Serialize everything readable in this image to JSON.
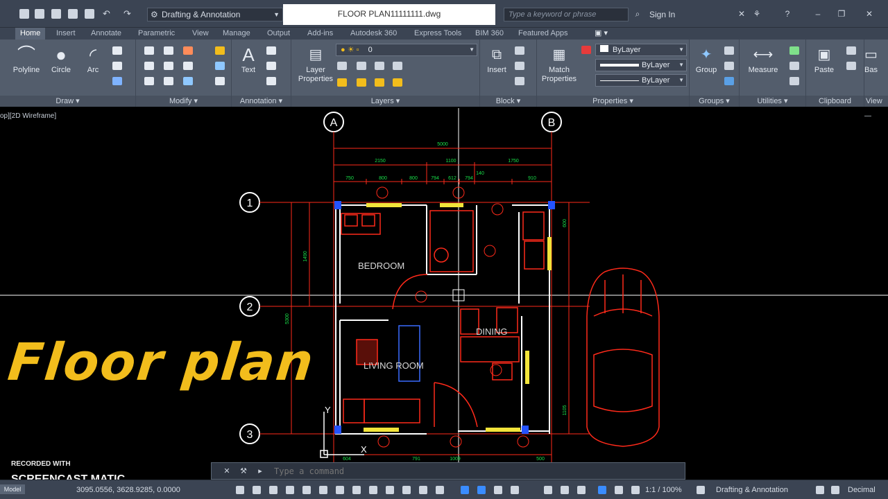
{
  "titlebar": {
    "workspace": "Drafting & Annotation",
    "document_title": "FLOOR PLAN11111111.dwg",
    "search_placeholder": "Type a keyword or phrase",
    "sign_in": "Sign In"
  },
  "ribbon_tabs": [
    "Home",
    "Insert",
    "Annotate",
    "Parametric",
    "View",
    "Manage",
    "Output",
    "Add-ins",
    "Autodesk 360",
    "Express Tools",
    "BIM 360",
    "Featured Apps"
  ],
  "ribbon": {
    "draw": {
      "title": "Draw",
      "tools": [
        "Polyline",
        "Circle",
        "Arc"
      ]
    },
    "modify": {
      "title": "Modify"
    },
    "annotation": {
      "title": "Annotation",
      "tool": "Text"
    },
    "layers": {
      "title": "Layers",
      "tool_line1": "Layer",
      "tool_line2": "Properties",
      "current_layer": "0"
    },
    "block": {
      "title": "Block",
      "tool": "Insert"
    },
    "properties": {
      "title": "Properties",
      "tool_line1": "Match",
      "tool_line2": "Properties",
      "color": "ByLayer",
      "linetype": "ByLayer",
      "lineweight": "ByLayer"
    },
    "groups": {
      "title": "Groups",
      "tool": "Group"
    },
    "utilities": {
      "title": "Utilities",
      "tool": "Measure"
    },
    "clipboard": {
      "title": "Clipboard",
      "tool": "Paste"
    },
    "view": {
      "title": "View",
      "tool": "Bas"
    }
  },
  "viewport": {
    "label": "op][2D Wireframe]"
  },
  "drawing": {
    "grid_columns": [
      "A",
      "B"
    ],
    "grid_rows": [
      "1",
      "2",
      "3"
    ],
    "overall_dimension": "5000",
    "dims_level2": [
      "2150",
      "1100",
      "1750"
    ],
    "dims_level3": [
      "750",
      "800",
      "800",
      "794",
      "612",
      "794",
      "140",
      "910"
    ],
    "dims_bottom": [
      "604",
      "791",
      "1009",
      "500"
    ],
    "dims_left": [
      "1490",
      "5300"
    ],
    "dims_right": [
      "600",
      "1105"
    ],
    "rooms": [
      "BEDROOM",
      "DINING",
      "LIVING ROOM"
    ]
  },
  "overlay_caption": "Floor plan",
  "watermark": {
    "recorded_with": "RECORDED WITH",
    "brand": "SCREENCAST MATIC"
  },
  "command_line": {
    "placeholder": "Type a command"
  },
  "statusbar": {
    "layout_tab": "Model",
    "coordinates": "3095.0556, 3628.9285, 0.0000",
    "annotation_scale": "1:1 / 100%",
    "workspace": "Drafting & Annotation",
    "units": "Decimal"
  },
  "colors": {
    "plan_red": "#ff2a1a",
    "dim_green": "#19e34a",
    "accent_yellow": "#f2bd1c",
    "ui_dark": "#3b4453"
  }
}
